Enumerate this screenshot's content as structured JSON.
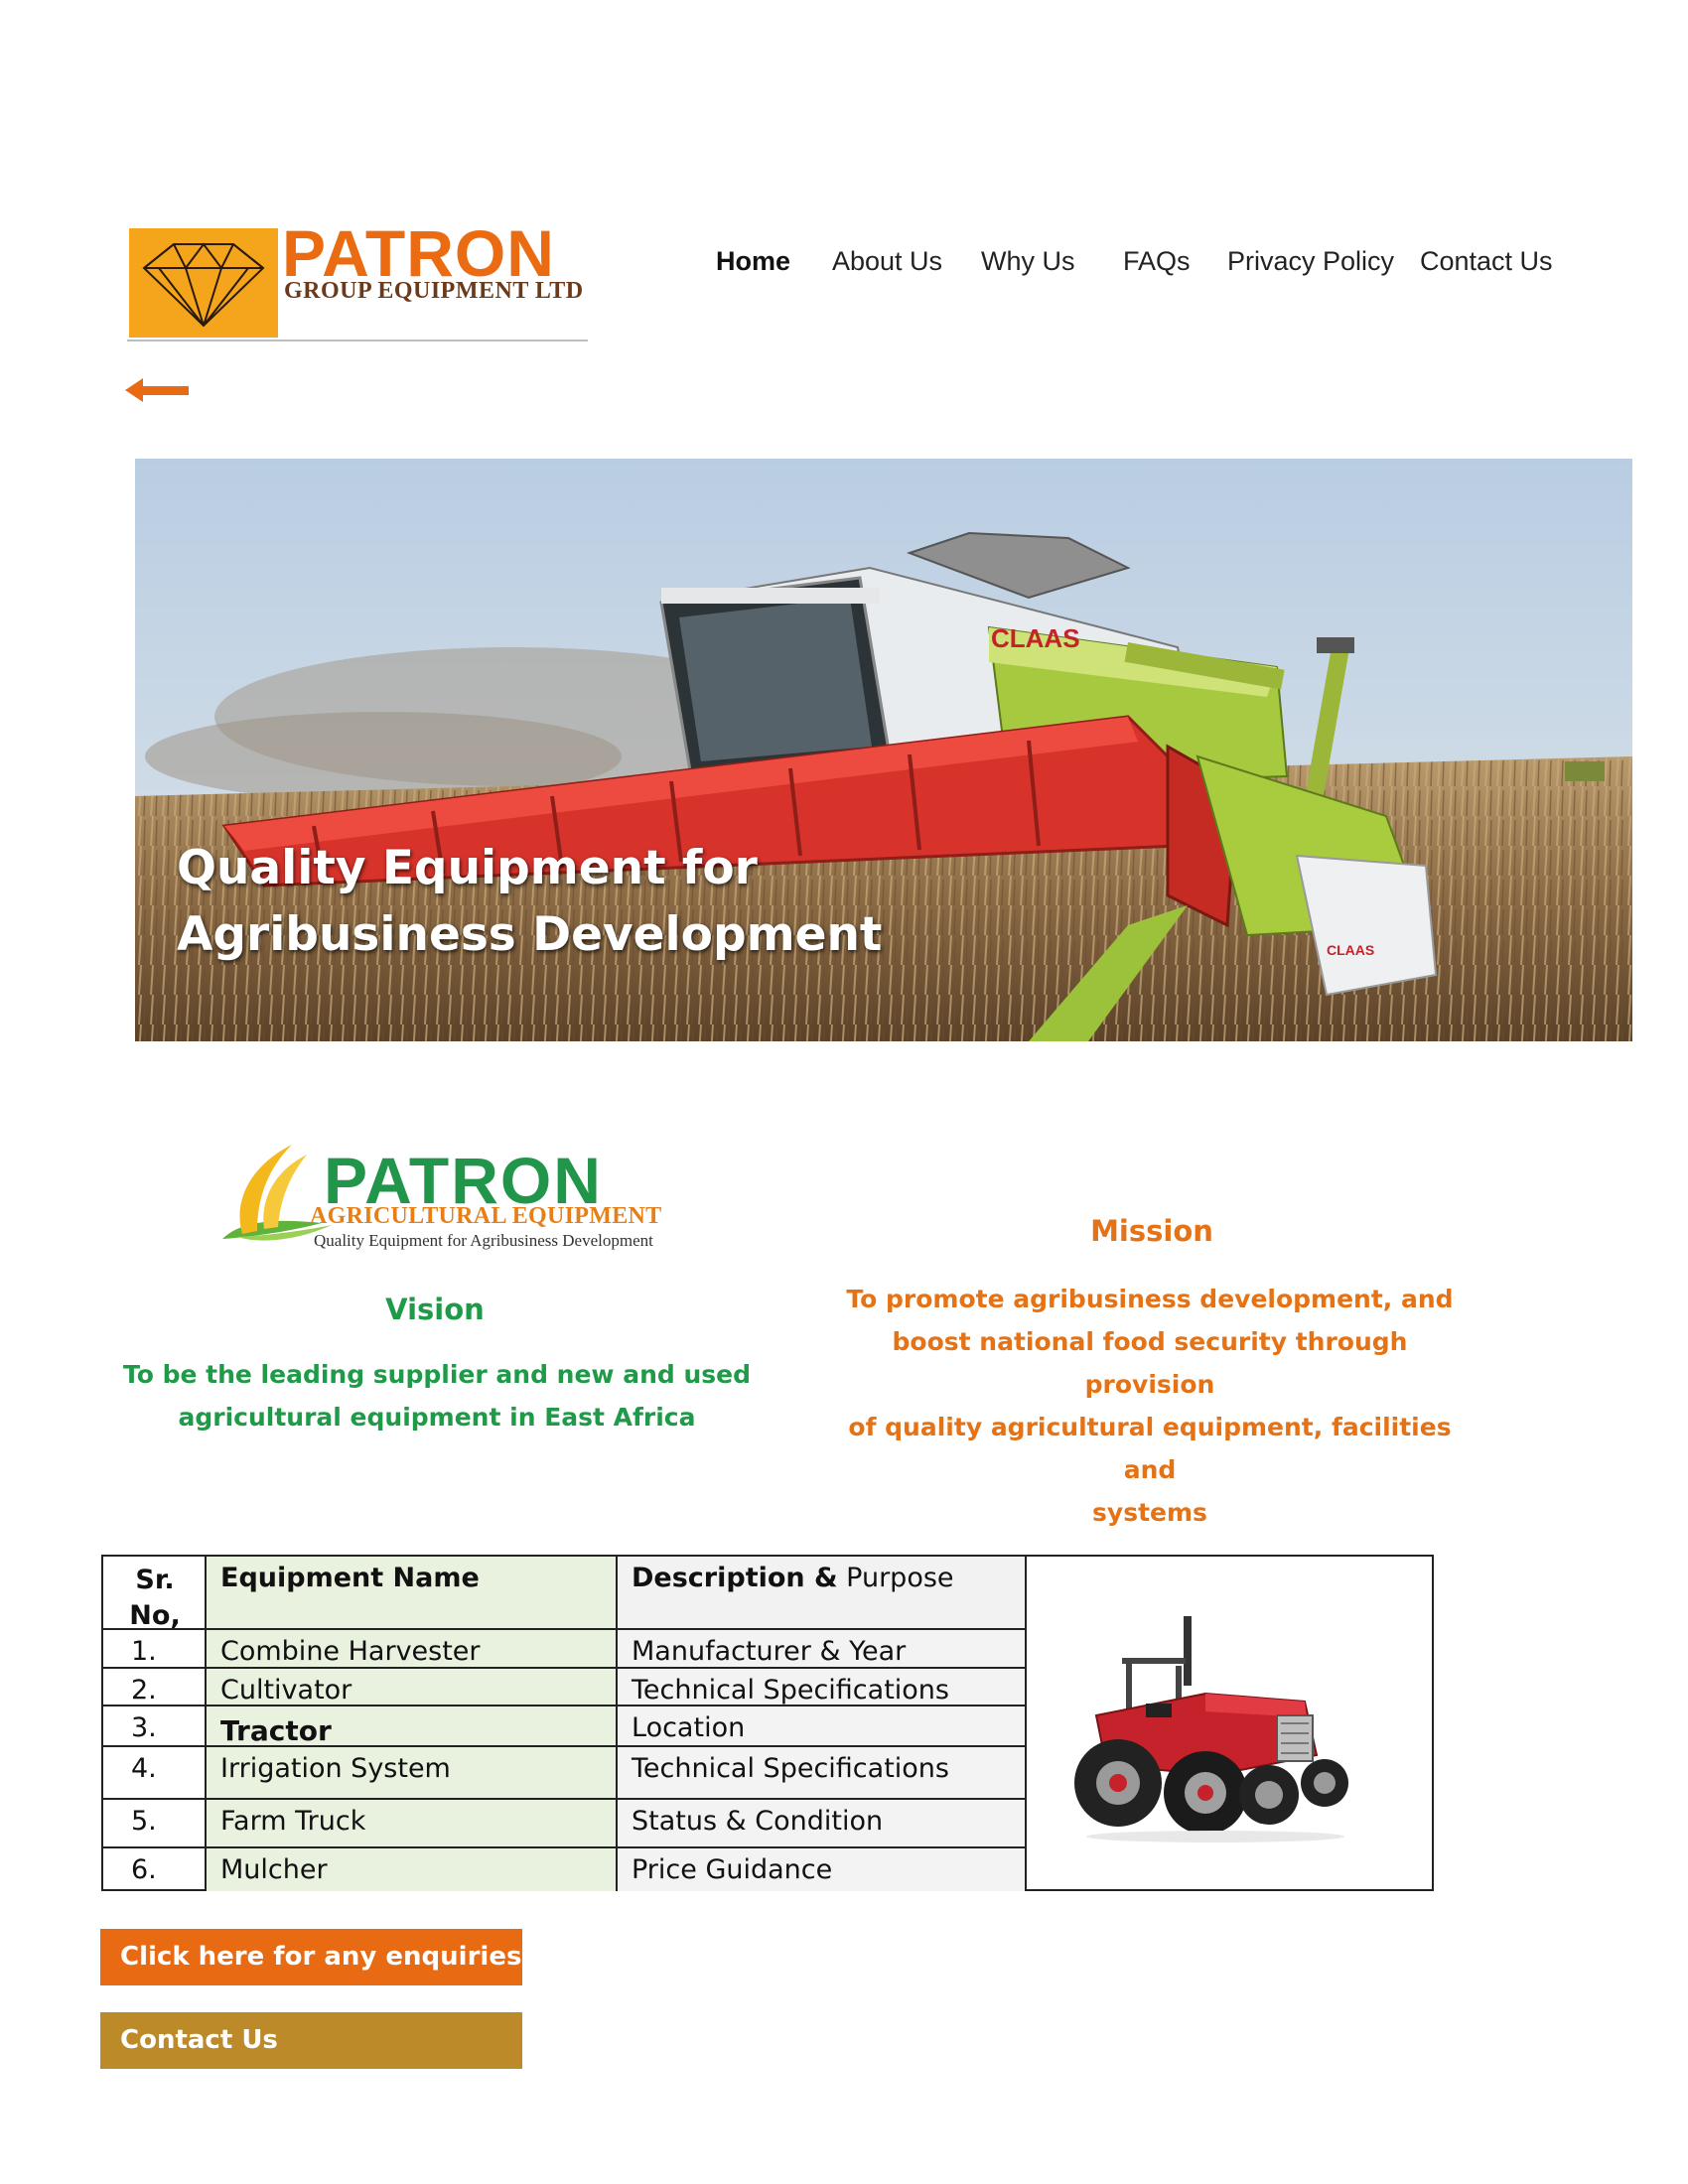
{
  "brand": {
    "name": "PATRON",
    "subtitle": "GROUP EQUIPMENT LTD",
    "accent_orange": "#ea6b12",
    "accent_gold": "#f5a51c"
  },
  "nav": {
    "items": [
      {
        "label": "Home",
        "active": true
      },
      {
        "label": "About Us"
      },
      {
        "label": "Why Us"
      },
      {
        "label": "FAQs"
      },
      {
        "label": "Privacy Policy"
      },
      {
        "label": "Contact Us"
      }
    ]
  },
  "back": {
    "icon": "arrow-left-icon"
  },
  "hero": {
    "title_line1": "Quality Equipment for",
    "title_line2": "Agribusiness Development"
  },
  "agri_logo": {
    "name": "PATRON",
    "subtitle": "AGRICULTURAL EQUIPMENT",
    "tagline": "Quality Equipment for Agribusiness Development",
    "accent_green": "#21954a"
  },
  "vision": {
    "heading": "Vision",
    "line1": "To be the leading supplier and new and used",
    "line2": "agricultural equipment in East Africa"
  },
  "mission": {
    "heading": "Mission",
    "line1": "To promote agribusiness development, and",
    "line2": "boost national food security through provision",
    "line3": "of quality agricultural equipment, facilities and",
    "line4": "systems"
  },
  "table": {
    "headers": {
      "sr_line1": "Sr.",
      "sr_line2": "No,",
      "name": "Equipment Name",
      "desc_bold": "Description &",
      "desc_rest": " Purpose"
    },
    "rows": [
      {
        "sr": "1.",
        "name": "Combine Harvester",
        "desc": "Manufacturer & Year"
      },
      {
        "sr": "2.",
        "name": "Cultivator",
        "desc": "Technical Specifications"
      },
      {
        "sr": "3.",
        "name": "Tractor",
        "desc": "Location"
      },
      {
        "sr": "4.",
        "name": "Irrigation System",
        "desc": "Technical Specifications"
      },
      {
        "sr": "5.",
        "name": "Farm Truck",
        "desc": "Status & Condition"
      },
      {
        "sr": "6.",
        "name": "Mulcher",
        "desc": "Price Guidance"
      }
    ]
  },
  "buttons": {
    "enquiry": "Click here for any enquiries",
    "contact": "Contact Us"
  }
}
